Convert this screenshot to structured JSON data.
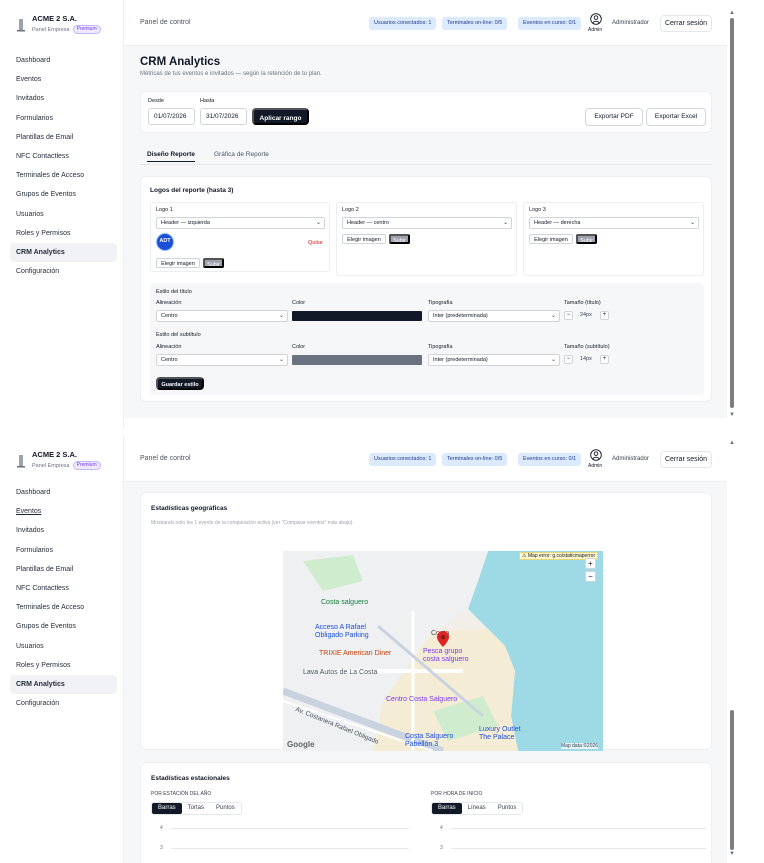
{
  "brand": {
    "name": "ACME 2 S.A.",
    "plan": "Panel Empresa",
    "badge": "Premium"
  },
  "nav": [
    "Dashboard",
    "Eventos",
    "Invitados",
    "Formularios",
    "Plantillas de Email",
    "NFC Contactless",
    "Terminales de Acceso",
    "Grupos de Eventos",
    "Usuarios",
    "Roles y Permisos",
    "CRM Analytics",
    "Configuración"
  ],
  "nav_active": "CRM Analytics",
  "header": {
    "breadcrumb": "Panel de control",
    "connected_users": "Usuarios conectados: 1",
    "terminals_online": "Terminales on-line: 0/5",
    "events_running": "Eventos en curso: 0/1",
    "admin_caption": "Admin",
    "admin_name": "Administrador",
    "logout": "Cerrar sesión"
  },
  "page": {
    "title": "CRM Analytics",
    "subtitle": "Métricas de tus eventos e invitados — según la retención de tu plan."
  },
  "range": {
    "from_label": "Desde",
    "from_value": "01/07/2026",
    "to_label": "Hasta",
    "to_value": "31/07/2026",
    "apply": "Aplicar rango",
    "export_pdf": "Exportar PDF",
    "export_excel": "Exportar Excel"
  },
  "tabs": [
    "Diseño Reporte",
    "Gráfica de Reporte"
  ],
  "logos": {
    "title": "Logos del reporte (hasta 3)",
    "items": [
      {
        "label": "Logo 1",
        "position": "Header — izquierda",
        "choose": "Elegir imagen",
        "upload": "Subir",
        "remove": "Quitar",
        "logo_text": "ADT"
      },
      {
        "label": "Logo 2",
        "position": "Header — centro",
        "choose": "Elegir imagen",
        "upload": "Subir"
      },
      {
        "label": "Logo 3",
        "position": "Header — derecha",
        "choose": "Elegir imagen",
        "upload": "Subir"
      }
    ]
  },
  "title_style": {
    "section": "Estilo del título",
    "align_label": "Alineación",
    "align_value": "Centro",
    "color_label": "Color",
    "color": "#111827",
    "font_label": "Tipografía",
    "font_value": "Inter (predeterminada)",
    "size_label": "Tamaño (título)",
    "size_value": "24px"
  },
  "subtitle_style": {
    "section": "Estilo del subtítulo",
    "align_label": "Alineación",
    "align_value": "Centro",
    "color_label": "Color",
    "color": "#6b7280",
    "font_label": "Tipografía",
    "font_value": "Inter (predeterminada)",
    "size_label": "Tamaño (subtítulo)",
    "size_value": "14px"
  },
  "save_style": "Guardar estilo",
  "stepper": {
    "minus": "−",
    "plus": "+"
  },
  "geo": {
    "title": "Estadísticas geográficas",
    "note": "Mostrando solo los 1 evento de la comparación activa (ver \"Comparar eventos\" más abajo).",
    "map_error": "⚠ Map error: g.co/staticmaperror",
    "map_credit": "Map data ©2026",
    "google": "Google",
    "zoom_in": "+",
    "zoom_out": "−",
    "places": [
      "Costa salguero",
      "Acceso A Rafael Obligado Parking",
      "TRIXIE American Diner",
      "Lava Autos de La Costa",
      "Centro Costa Salguero",
      "Costa Salguero Pabellón 3",
      "Luxury Outlet The Palace",
      "Pesca grupo costa salguero",
      "Costa",
      "Av. Costanera Rafael Obligado"
    ]
  },
  "seasonal": {
    "title": "Estadísticas estacionales",
    "by_season": "POR ESTACIÓN DEL AÑO",
    "by_hour": "POR HORA DE INICIO",
    "season_modes": [
      "Barras",
      "Tortas",
      "Puntos"
    ],
    "hour_modes": [
      "Barras",
      "Líneas",
      "Puntos"
    ],
    "y_ticks": [
      "4",
      "3"
    ]
  },
  "colors": {
    "accent_dark": "#111827",
    "pill_bg": "#dbeafe",
    "badge_purple": "#7c3aed",
    "danger": "#dc2626"
  }
}
